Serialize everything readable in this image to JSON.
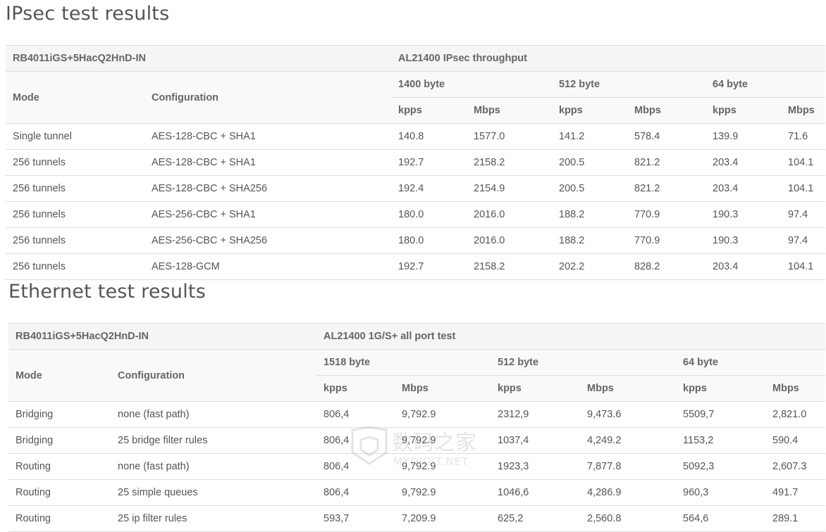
{
  "ipsec": {
    "title": "IPsec test results",
    "device": "RB4011iGS+5HacQ2HnD-IN",
    "test_name": "AL21400 IPsec throughput",
    "mode_label": "Mode",
    "config_label": "Configuration",
    "sizes": [
      "1400 byte",
      "512 byte",
      "64 byte"
    ],
    "unit_kpps": "kpps",
    "unit_mbps": "Mbps",
    "rows": [
      {
        "mode": "Single tunnel",
        "config": "AES-128-CBC + SHA1",
        "v": [
          "140.8",
          "1577.0",
          "141.2",
          "578.4",
          "139.9",
          "71.6"
        ]
      },
      {
        "mode": "256 tunnels",
        "config": "AES-128-CBC + SHA1",
        "v": [
          "192.7",
          "2158.2",
          "200.5",
          "821.2",
          "203.4",
          "104.1"
        ]
      },
      {
        "mode": "256 tunnels",
        "config": "AES-128-CBC + SHA256",
        "v": [
          "192.4",
          "2154.9",
          "200.5",
          "821.2",
          "203.4",
          "104.1"
        ]
      },
      {
        "mode": "256 tunnels",
        "config": "AES-256-CBC + SHA1",
        "v": [
          "180.0",
          "2016.0",
          "188.2",
          "770.9",
          "190.3",
          "97.4"
        ]
      },
      {
        "mode": "256 tunnels",
        "config": "AES-256-CBC + SHA256",
        "v": [
          "180.0",
          "2016.0",
          "188.2",
          "770.9",
          "190.3",
          "97.4"
        ]
      },
      {
        "mode": "256 tunnels",
        "config": "AES-128-GCM",
        "v": [
          "192.7",
          "2158.2",
          "202.2",
          "828.2",
          "203.4",
          "104.1"
        ]
      }
    ]
  },
  "ethernet": {
    "title": "Ethernet test results",
    "device": "RB4011iGS+5HacQ2HnD-IN",
    "test_name": "AL21400 1G/S+ all port test",
    "mode_label": "Mode",
    "config_label": "Configuration",
    "sizes": [
      "1518 byte",
      "512 byte",
      "64 byte"
    ],
    "unit_kpps": "kpps",
    "unit_mbps": "Mbps",
    "rows": [
      {
        "mode": "Bridging",
        "config": "none (fast path)",
        "v": [
          "806,4",
          "9,792.9",
          "2312,9",
          "9,473.6",
          "5509,7",
          "2,821.0"
        ]
      },
      {
        "mode": "Bridging",
        "config": "25 bridge filter rules",
        "v": [
          "806,4",
          "9,792.9",
          "1037,4",
          "4,249.2",
          "1153,2",
          "590.4"
        ]
      },
      {
        "mode": "Routing",
        "config": "none (fast path)",
        "v": [
          "806,4",
          "9,792.9",
          "1923,3",
          "7,877.8",
          "5092,3",
          "2,607.3"
        ]
      },
      {
        "mode": "Routing",
        "config": "25 simple queues",
        "v": [
          "806,4",
          "9,792.9",
          "1046,6",
          "4,286.9",
          "960,3",
          "491.7"
        ]
      },
      {
        "mode": "Routing",
        "config": "25 ip filter rules",
        "v": [
          "593,7",
          "7,209.9",
          "625,2",
          "2,560.8",
          "564,6",
          "289.1"
        ]
      }
    ]
  },
  "watermark": {
    "brand_cn": "数码之家",
    "brand_en": "MYDIGIT.NET"
  }
}
